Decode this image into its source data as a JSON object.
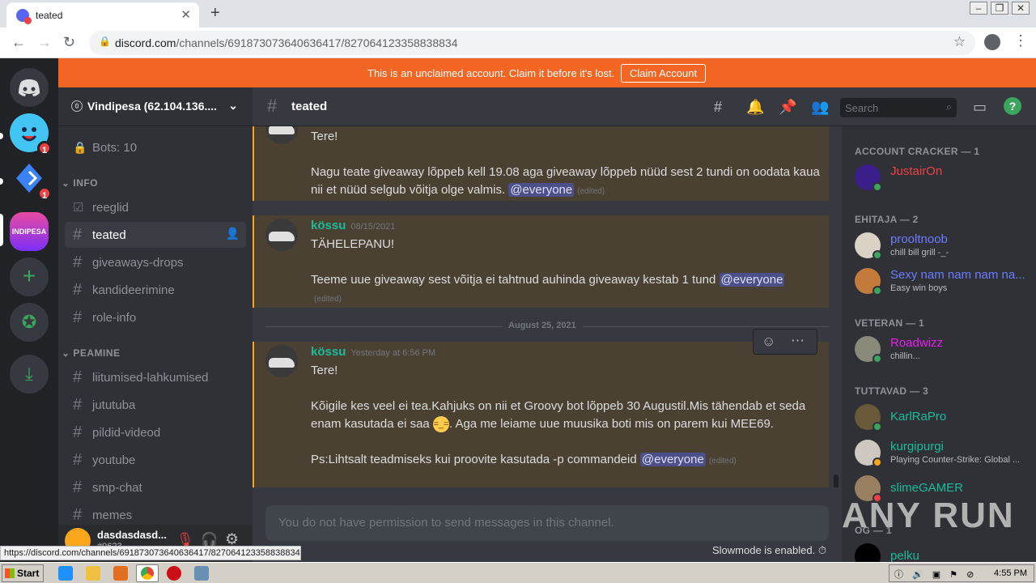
{
  "browser": {
    "tab_title": "teated",
    "url_domain": "discord.com",
    "url_path": "/channels/691873073640636417/827064123358838834",
    "status_url": "https://discord.com/channels/691873073640636417/827064123358838834"
  },
  "banner": {
    "message": "This is an unclaimed account. Claim it before it's lost.",
    "button": "Claim Account"
  },
  "rail": {
    "badge1": "1",
    "badge2": "1",
    "server_label": "INDIPESA"
  },
  "server": {
    "name": "Vindipesa (62.104.136....",
    "boost": "0"
  },
  "channels": {
    "bots": "Bots: 10",
    "cat_info": "INFO",
    "cat_peamine": "PEAMINE",
    "items": [
      "reeglid",
      "teated",
      "giveaways-drops",
      "kandideerimine",
      "role-info",
      "liitumised-lahkumised",
      "jututuba",
      "pildid-videod",
      "youtube",
      "smp-chat",
      "memes"
    ]
  },
  "user": {
    "name": "dasdasdasd...",
    "tag": "#0623"
  },
  "channel_header": {
    "name": "teated",
    "search_placeholder": "Search"
  },
  "messages": {
    "m1_line1": "Tere!",
    "m1_line2": "Nagu teate giveaway lõppeb kell 19.08 aga  giveaway lõppeb nüüd sest 2 tundi on oodata kaua nii et nüüd selgub võitja olge valmis.",
    "m2_author": "kössu",
    "m2_time": "08/15/2021",
    "m2_line1": "TÄHELEPANU!",
    "m2_line2": "Teeme uue giveaway sest võitja ei tahtnud auhinda giveaway kestab 1 tund",
    "divider": "August 25, 2021",
    "m3_author": "kössu",
    "m3_time": "Yesterday at 6:56 PM",
    "m3_line1": "Tere!",
    "m3_line2a": "Kõigile kes veel ei tea.Kahjuks on nii et Groovy bot lõppeb 30 Augustil.Mis tähendab et seda enam kasutada ei saa",
    "m3_line2b": ". Aga me leiame uue muusika boti mis on parem kui MEE69.",
    "m3_line3": "Ps:Lihtsalt teadmiseks kui proovite kasutada -p commandeid",
    "mention": "@everyone",
    "edited": "(edited)"
  },
  "composer": {
    "placeholder": "You do not have permission to send messages in this channel."
  },
  "slowmode": "Slowmode is enabled.",
  "members": {
    "cat1": "ACCOUNT CRACKER — 1",
    "m1": "JustairOn",
    "cat2": "EHITAJA — 2",
    "m2": "prooltnoob",
    "m2_act": "chill bill grill -_-",
    "m3": "Sexy nam nam nam na...",
    "m3_act": "Easy win boys",
    "cat3": "VETERAN — 1",
    "m4": "Roadwizz",
    "m4_act": "chillin...",
    "cat4": "TUTTAVAD — 3",
    "m5": "KarlRaPro",
    "m6": "kurgipurgi",
    "m6_act": "Playing Counter-Strike: Global ...",
    "m7": "slimeGAMER",
    "cat5": "OG — 1",
    "m8": "pelku"
  },
  "watermark": "ANY RUN",
  "taskbar": {
    "start": "Start",
    "clock": "4:55 PM"
  },
  "colors": {
    "accent": "#5865f2",
    "banner": "#f26522",
    "highlight": "#faa61a"
  }
}
